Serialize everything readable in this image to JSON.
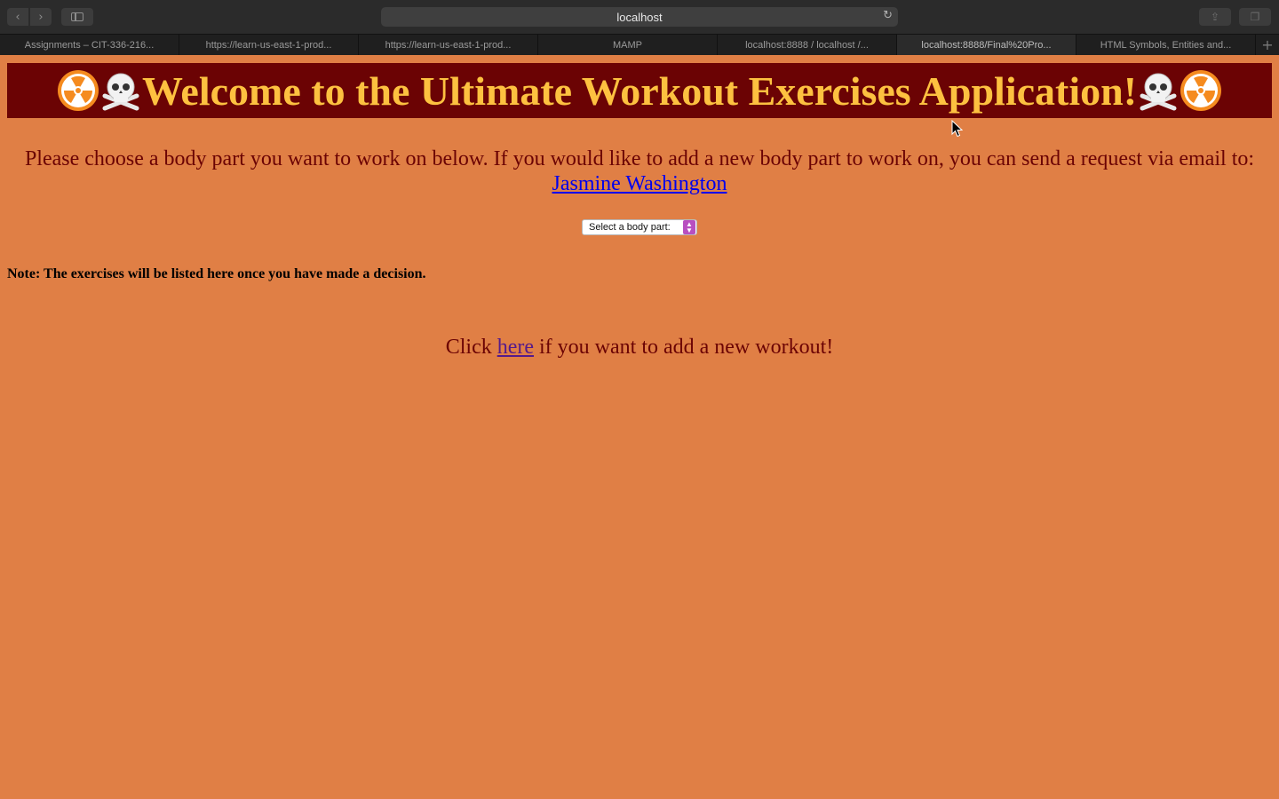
{
  "browser": {
    "address": "localhost",
    "tabs": [
      {
        "label": "Assignments – CIT-336-216..."
      },
      {
        "label": "https://learn-us-east-1-prod..."
      },
      {
        "label": "https://learn-us-east-1-prod..."
      },
      {
        "label": "MAMP"
      },
      {
        "label": "localhost:8888 / localhost /..."
      },
      {
        "label": "localhost:8888/Final%20Pro...",
        "active": true
      },
      {
        "label": "HTML Symbols, Entities and..."
      }
    ]
  },
  "page": {
    "title": "Welcome to the Ultimate Workout Exercises Application!",
    "title_icons": [
      "radioactive-icon",
      "skull-crossbones-icon"
    ],
    "intro_text": "Please choose a body part you want to work on below. If you would like to add a new body part to work on, you can send a request via email to:",
    "contact_link": "Jasmine Washington",
    "select_label": "Select a body part:",
    "note": "Note: The exercises will be listed here once you have made a decision.",
    "add_prefix": "Click",
    "add_link": "here",
    "add_suffix": "if you want to add a new workout!"
  },
  "colors": {
    "background": "#e07f45",
    "banner_bg": "#6b0304",
    "banner_text": "#fdc140",
    "body_text": "#6b0304"
  }
}
